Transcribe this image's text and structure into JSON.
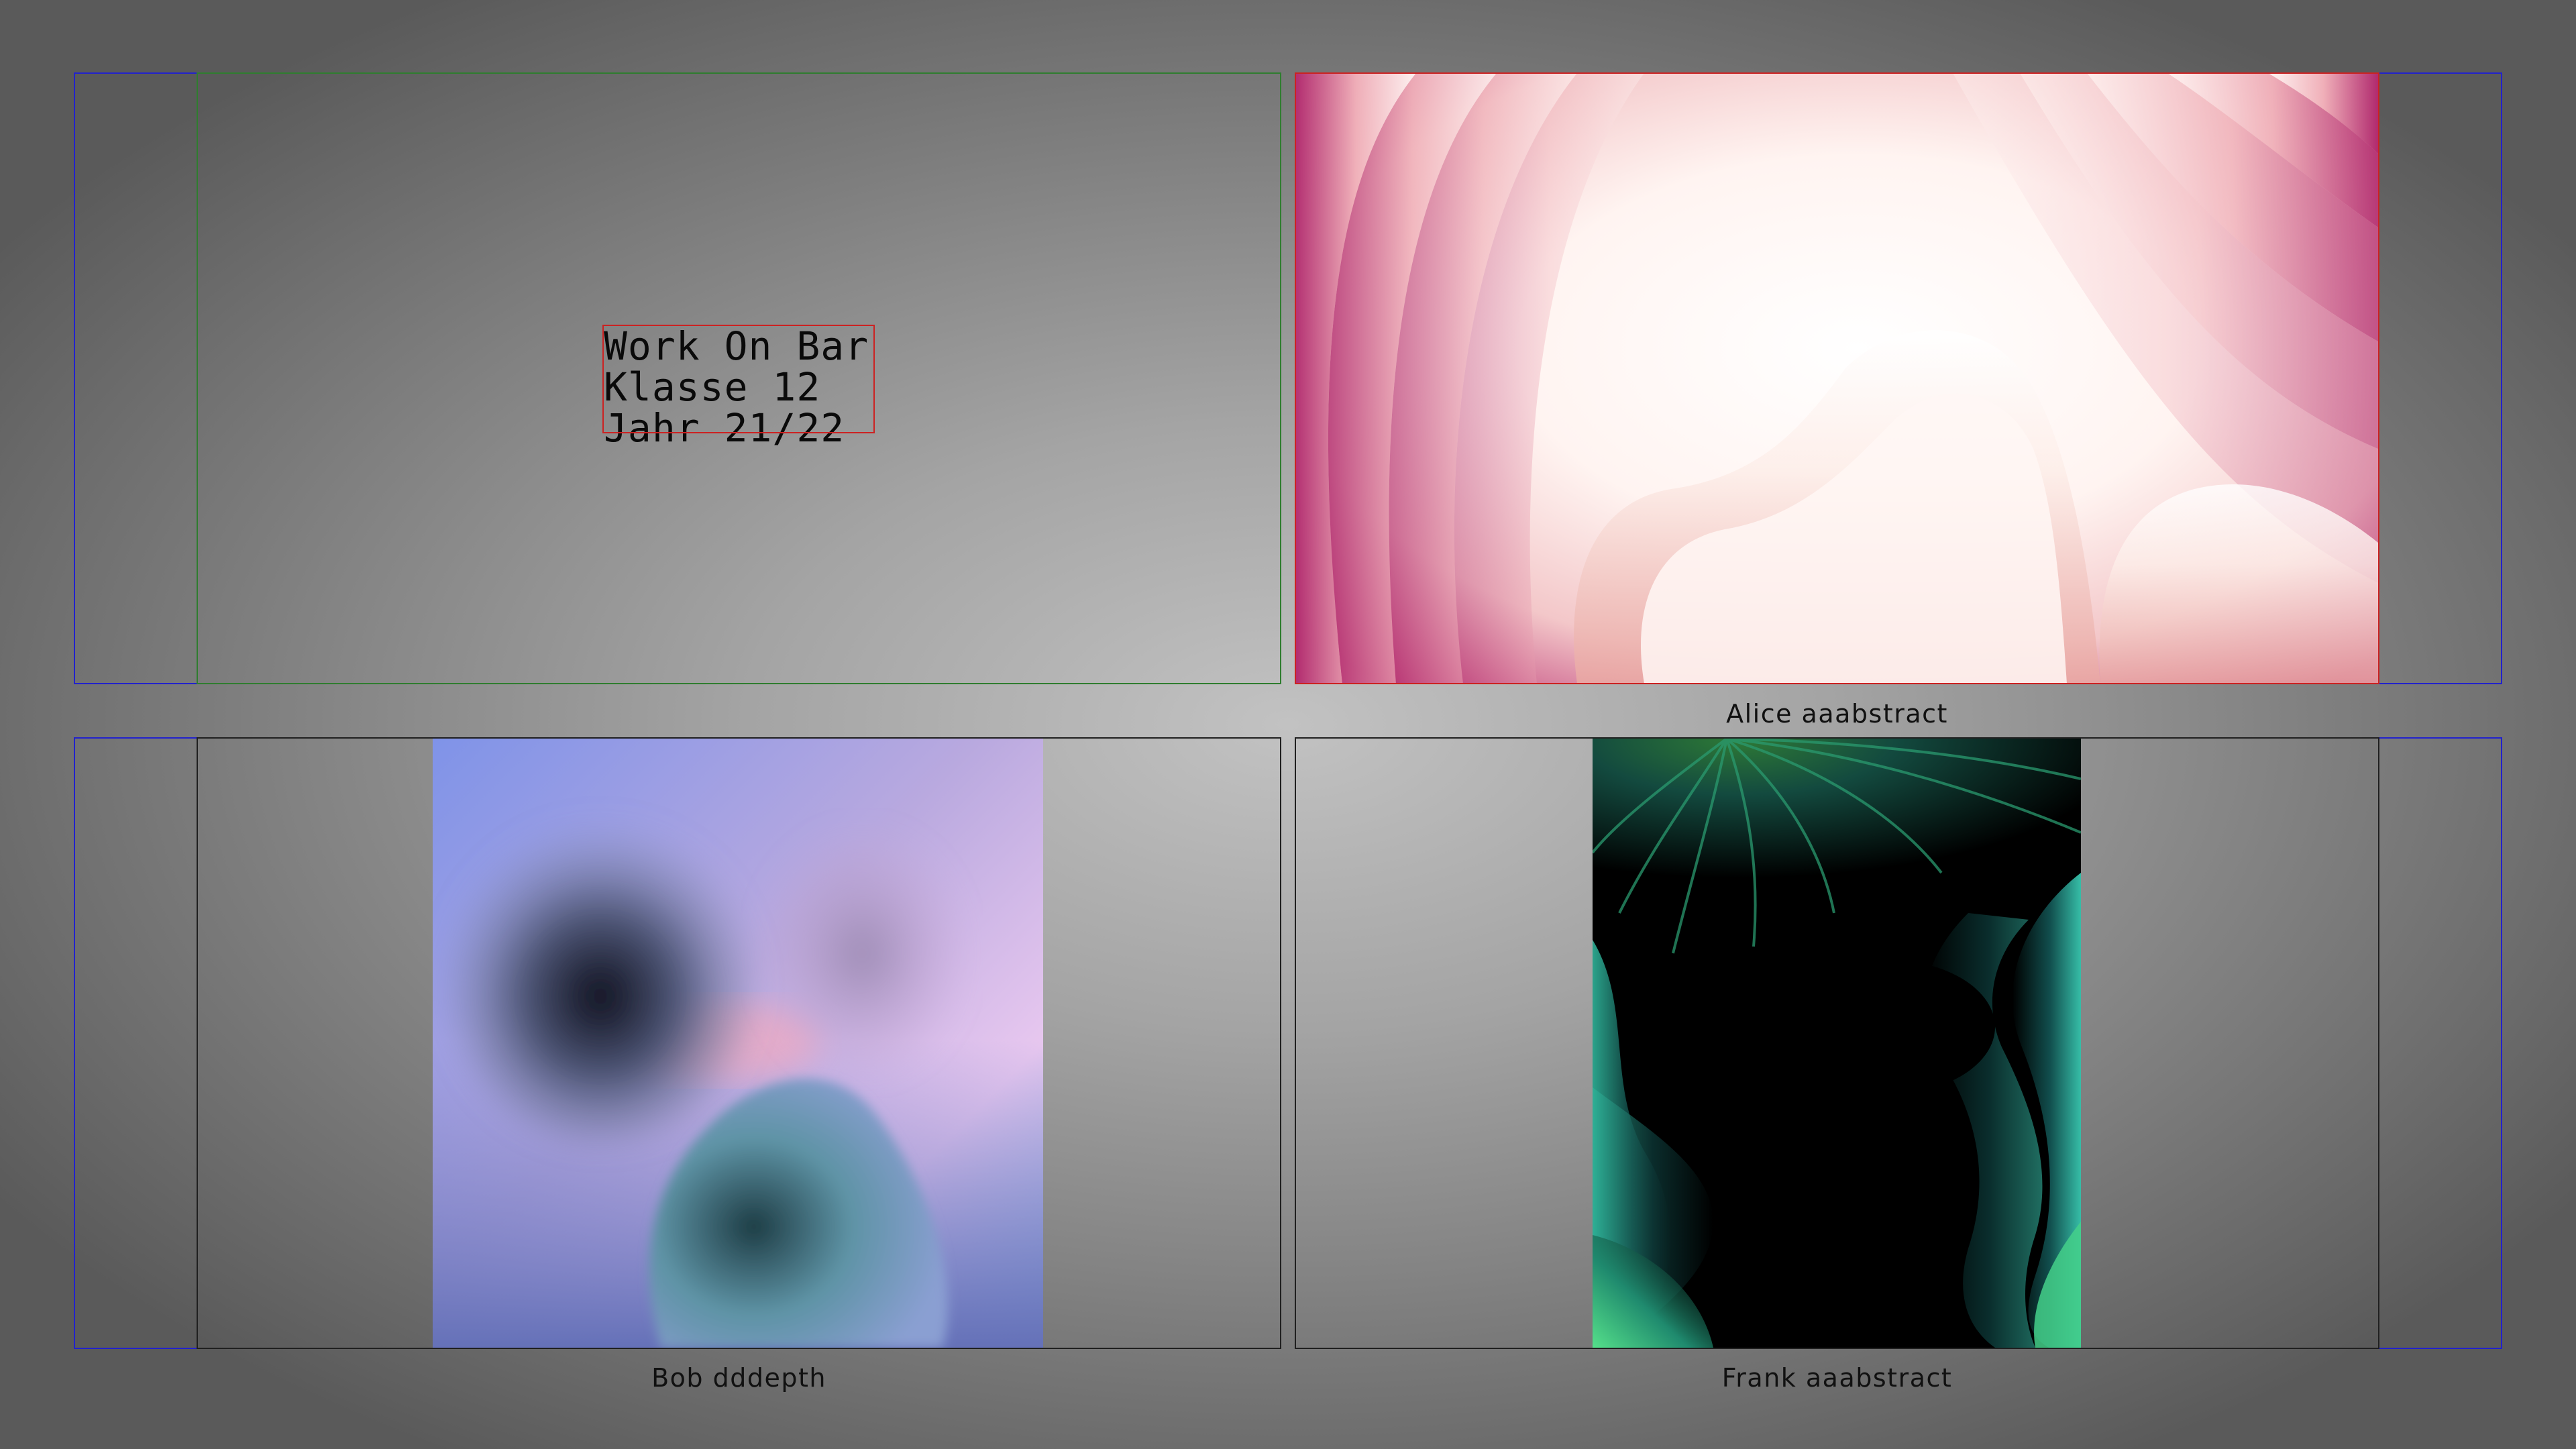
{
  "title_card": {
    "lines": [
      "Work On Bar",
      "Klasse 12",
      "Jahr 21/22"
    ]
  },
  "tiles": [
    {
      "id": "alice",
      "caption": "Alice aaabstract",
      "icon": "abstract-pink-waves-image"
    },
    {
      "id": "bob",
      "caption": "Bob dddepth",
      "icon": "abstract-blurred-shapes-image"
    },
    {
      "id": "frank",
      "caption": "Frank aaabstract",
      "icon": "abstract-teal-waves-image"
    }
  ],
  "colors": {
    "outline_blue": "#2222cc",
    "outline_green": "#2f7d2f",
    "outline_red": "#cc2222",
    "outline_black": "#202020"
  }
}
